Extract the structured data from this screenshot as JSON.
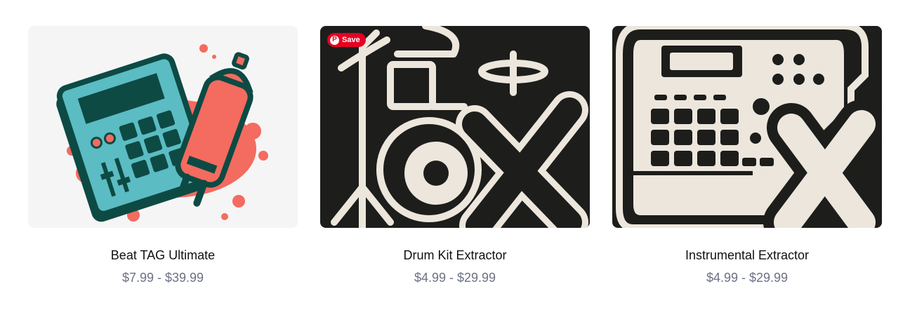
{
  "products": [
    {
      "title": "Beat TAG Ultimate",
      "price": "$7.99 - $39.99",
      "image_icon": "drum-machine-spray-can-icon"
    },
    {
      "title": "Drum Kit Extractor",
      "price": "$4.99 - $29.99",
      "image_icon": "drum-kit-x-icon"
    },
    {
      "title": "Instrumental Extractor",
      "price": "$4.99 - $29.99",
      "image_icon": "sampler-x-icon"
    }
  ],
  "pinterest": {
    "save_label": "Save",
    "logo": "P"
  },
  "colors": {
    "cream": "#ece6dc",
    "dark": "#1d1d1b",
    "teal": "#5bbcc3",
    "coral": "#f46b5f",
    "deep_green": "#0d4a44"
  }
}
